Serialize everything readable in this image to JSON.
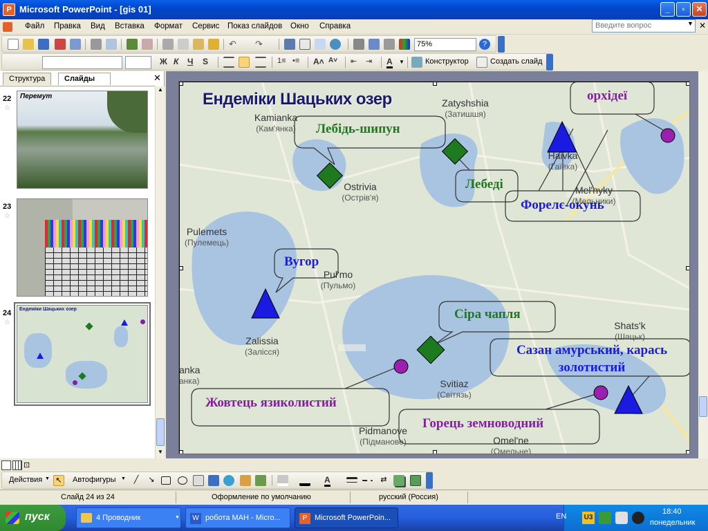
{
  "window": {
    "title": "Microsoft PowerPoint - [gis 01]"
  },
  "menu": [
    "Файл",
    "Правка",
    "Вид",
    "Вставка",
    "Формат",
    "Сервис",
    "Показ слайдов",
    "Окно",
    "Справка"
  ],
  "help_placeholder": "Введите вопрос",
  "toolbar": {
    "zoom": "75%",
    "designer_label": "Конструктор",
    "new_slide_label": "Создать слайд"
  },
  "left_panel": {
    "tabs": [
      "Структура",
      "Слайды"
    ],
    "slides": [
      {
        "num": "22",
        "caption": "Перемут"
      },
      {
        "num": "23",
        "caption": ""
      },
      {
        "num": "24",
        "caption": "Ендеміки Шацьких озер"
      }
    ]
  },
  "slide": {
    "title": "Ендеміки Шацьких озер",
    "places": [
      {
        "name": "Kamianka",
        "sub": "(Кам'янка)"
      },
      {
        "name": "Zatyshshia",
        "sub": "(Затишшя)"
      },
      {
        "name": "Haivka",
        "sub": "(Гаївка)"
      },
      {
        "name": "Ostrivia",
        "sub": "(Острів'я)"
      },
      {
        "name": "Mel'nyky",
        "sub": "(Мельники)"
      },
      {
        "name": "Pulemets",
        "sub": "(Пулемець)"
      },
      {
        "name": "Pul'mo",
        "sub": "(Пульмо)"
      },
      {
        "name": "Zalissia",
        "sub": "(Залісся)"
      },
      {
        "name": "Shats'k",
        "sub": "(Шацьк)"
      },
      {
        "name": "Svitiaz",
        "sub": "(Світязь)"
      },
      {
        "name": "anka",
        "sub": "анка)"
      },
      {
        "name": "Pidmanove",
        "sub": "(Підманове)"
      },
      {
        "name": "Omel'ne",
        "sub": "(Омельне)"
      }
    ],
    "callouts": {
      "swan": "Лебідь-шипун",
      "swans": "Лебеді",
      "orchids": "орхідеї",
      "trout": "Форелє-окунь",
      "eel": "Вугор",
      "heron": "Сіра чапля",
      "carp": "Сазан амурський, карась золотистий",
      "lily": "Жовтець язиколистий",
      "knotweed": "Горець земноводний"
    }
  },
  "draw_toolbar": {
    "actions": "Действия",
    "autoshapes": "Автофигуры"
  },
  "status": {
    "slide": "Слайд 24 из 24",
    "design": "Оформление по умолчанию",
    "lang": "русский (Россия)"
  },
  "taskbar": {
    "start": "пуск",
    "tasks": [
      "4 Проводник",
      "робота МАН - Micro...",
      "Microsoft PowerPoin..."
    ],
    "lang": "EN",
    "time": "18:40",
    "day": "понедельник"
  },
  "colors": {
    "green": "#1e7a1e",
    "blue": "#1a1ae0",
    "purple": "#8a1aa8",
    "water": "#a8c4e0"
  }
}
